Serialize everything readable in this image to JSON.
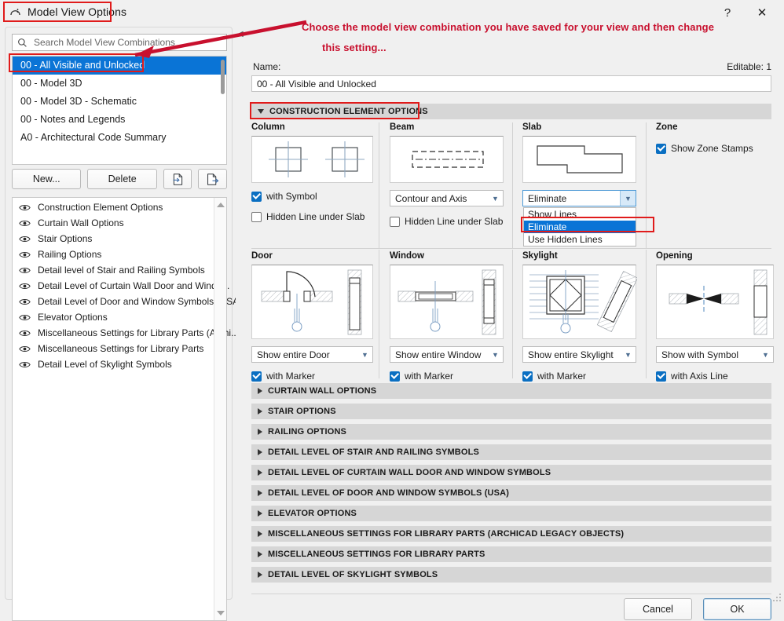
{
  "window": {
    "title": "Model View Options",
    "icon": "archicad-mvo-icon",
    "help_label": "?",
    "close_label": "✕"
  },
  "annotation": {
    "line1": "Choose the model view combination you have saved for your view and then change",
    "line2": "this setting...",
    "color": "#c8102e"
  },
  "left_panel": {
    "search": {
      "placeholder": "Search Model View Combinations",
      "value": "",
      "icon": "search-icon"
    },
    "combinations": [
      {
        "label": "00 - All Visible and Unlocked",
        "selected": true
      },
      {
        "label": "00 - Model 3D",
        "selected": false
      },
      {
        "label": "00 - Model 3D - Schematic",
        "selected": false
      },
      {
        "label": "00 - Notes and Legends",
        "selected": false
      },
      {
        "label": "A0 - Architectural Code Summary",
        "selected": false
      }
    ],
    "buttons": {
      "new_label": "New...",
      "delete_label": "Delete",
      "import_icon": "import-file-icon",
      "export_icon": "export-file-icon"
    },
    "feature_list": [
      "Construction Element Options",
      "Curtain Wall Options",
      "Stair Options",
      "Railing Options",
      "Detail level of Stair and Railing Symbols",
      "Detail Level of Curtain Wall Door and Windo...",
      "Detail Level of Door and Window Symbols (USA)",
      "Elevator Options",
      "Miscellaneous Settings for Library Parts (Archi...",
      "Miscellaneous Settings for Library Parts",
      "Detail Level of Skylight Symbols"
    ]
  },
  "right_panel": {
    "name_label": "Name:",
    "editable_label": "Editable: 1",
    "name_value": "00 - All Visible and Unlocked",
    "section_title": "CONSTRUCTION ELEMENT OPTIONS",
    "cells": {
      "column": {
        "title": "Column",
        "with_symbol": {
          "label": "with Symbol",
          "checked": true
        },
        "hidden_line": {
          "label": "Hidden Line under Slab",
          "checked": false
        }
      },
      "beam": {
        "title": "Beam",
        "select_value": "Contour and Axis",
        "hidden_line": {
          "label": "Hidden Line under Slab",
          "checked": false
        }
      },
      "slab": {
        "title": "Slab",
        "select_value": "Eliminate",
        "options": [
          "Show Lines",
          "Eliminate",
          "Use Hidden Lines"
        ],
        "selected_option": "Eliminate",
        "open": true
      },
      "zone": {
        "title": "Zone",
        "show_zone_stamps": {
          "label": "Show Zone Stamps",
          "checked": true
        }
      },
      "door": {
        "title": "Door",
        "select_value": "Show entire Door",
        "marker": {
          "label": "with Marker",
          "checked": true
        }
      },
      "window": {
        "title": "Window",
        "select_value": "Show entire Window",
        "marker": {
          "label": "with Marker",
          "checked": true
        }
      },
      "skylight": {
        "title": "Skylight",
        "select_value": "Show entire Skylight",
        "marker": {
          "label": "with Marker",
          "checked": true
        }
      },
      "opening": {
        "title": "Opening",
        "select_value": "Show with Symbol",
        "marker": {
          "label": "with Axis Line",
          "checked": true
        }
      }
    },
    "collapsed_sections": [
      "CURTAIN WALL OPTIONS",
      "STAIR OPTIONS",
      "RAILING OPTIONS",
      "DETAIL LEVEL OF STAIR AND RAILING SYMBOLS",
      "DETAIL LEVEL OF CURTAIN WALL DOOR AND WINDOW SYMBOLS",
      "DETAIL LEVEL OF DOOR AND WINDOW SYMBOLS (USA)",
      "ELEVATOR OPTIONS",
      "MISCELLANEOUS SETTINGS FOR LIBRARY PARTS (ARCHICAD LEGACY OBJECTS)",
      "MISCELLANEOUS SETTINGS FOR LIBRARY PARTS",
      "DETAIL LEVEL OF SKYLIGHT SYMBOLS"
    ],
    "footer": {
      "cancel_label": "Cancel",
      "ok_label": "OK"
    }
  }
}
